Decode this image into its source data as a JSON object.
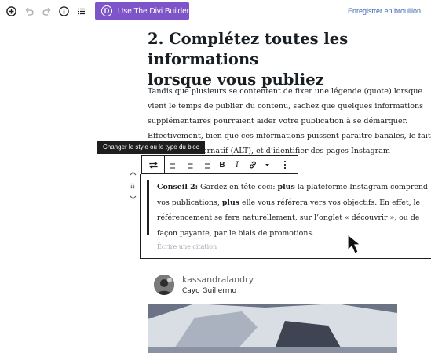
{
  "topbar": {
    "divi_button_label": "Use The Divi Builder",
    "divi_logo_letter": "D",
    "save_draft_label": "Enregistrer en brouillon"
  },
  "post": {
    "heading": "2. Complétez toutes les informations\nlorsque vous publiez",
    "paragraph": "Tandis que plusieurs se contentent de fixer une légende (quote)  lorsque\nvient le temps de publier du contenu, sachez que quelques informations\nsupplémentaires pourraient aider votre publication à se démarquer.\nEffectivement, bien que ces informations puissent paraitre banales, le fait\nde            de texte alternatif (ALT), et d’identifier des pages Instagram\n                                                    faire gagner de la visibilité."
  },
  "toolbar": {
    "tooltip": "Changer le style ou le type du bloc",
    "bold": "B",
    "italic": "I"
  },
  "quote": {
    "p1_label": "Conseil 2:",
    "p1a": " Gardez en tête ceci: ",
    "p1_bold2": "plus",
    "p1b": " la plateforme Instagram comprend vos publications, ",
    "p1_bold3": "plus",
    "p1c": " elle vous référera vers vos objectifs. En effet, le référencement se fera naturellement, sur l’onglet « découvrir », ou de façon payante, par le biais de promotions.",
    "citation_placeholder": "Écrire une citation"
  },
  "embed": {
    "username": "kassandralandry",
    "location": "Cayo Guillermo"
  },
  "icons": [
    "add-block-icon",
    "undo-icon",
    "redo-icon",
    "info-icon",
    "outline-icon",
    "transform-icon",
    "align-left-icon",
    "align-center-icon",
    "align-right-icon",
    "link-icon",
    "more-rich-text-icon",
    "more-options-icon",
    "move-up-icon",
    "drag-handle-icon",
    "move-down-icon",
    "mouse-cursor-icon"
  ],
  "colors": {
    "divi_purple": "#7e55c9",
    "draft_link": "#3b63b1",
    "dark": "#1e1e1e"
  }
}
